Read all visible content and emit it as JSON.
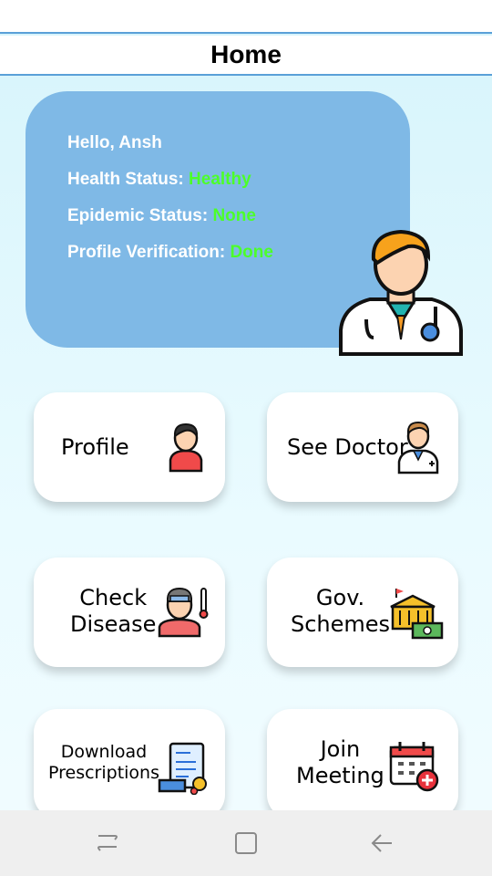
{
  "app": {
    "title": "Home"
  },
  "info": {
    "greeting": "Hello, Ansh",
    "health_label": "Health Status:",
    "health_value": "Healthy",
    "epidemic_label": "Epidemic Status:",
    "epidemic_value": "None",
    "verification_label": "Profile Verification:",
    "verification_value": "Done"
  },
  "tiles": [
    {
      "label": "Profile",
      "icon": "user-icon"
    },
    {
      "label": "See Doctor",
      "icon": "doctor-icon"
    },
    {
      "label_line1": "Check",
      "label_line2": "Disease",
      "icon": "sick-person-icon"
    },
    {
      "label_line1": "Gov.",
      "label_line2": "Schemes",
      "icon": "government-building-money-icon"
    },
    {
      "label_line1": "Download",
      "label_line2": "Prescriptions",
      "icon": "prescription-icon"
    },
    {
      "label_line1": "Join",
      "label_line2": "Meeting",
      "icon": "calendar-add-icon"
    }
  ],
  "colors": {
    "card": "#7fb9e6",
    "status_value": "#4cff2a",
    "header_border": "#5aa0d8"
  },
  "nav": {
    "recents_icon": "recents-icon",
    "home_icon": "home-square-icon",
    "back_icon": "back-arrow-icon"
  }
}
